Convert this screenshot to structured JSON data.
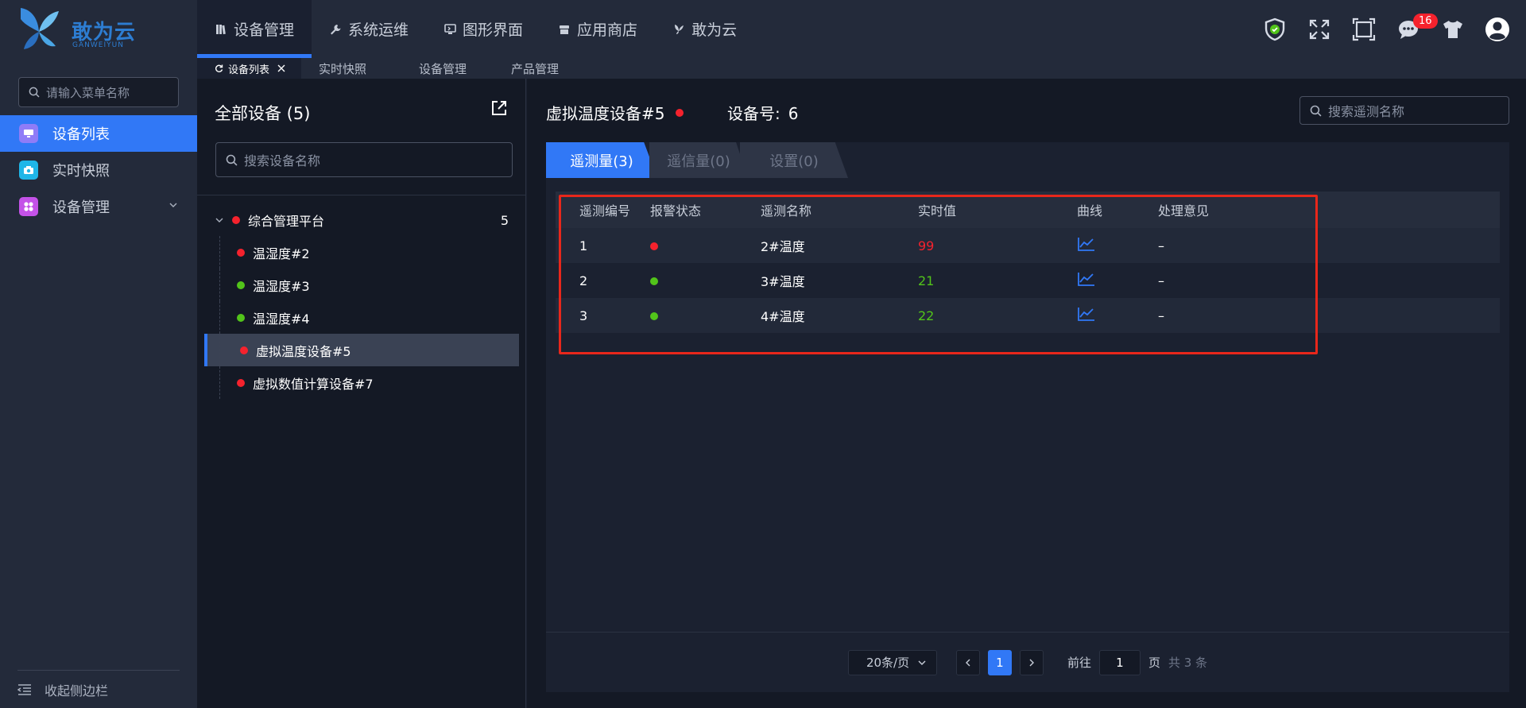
{
  "logo": {
    "text": "敢为云",
    "sub": "GANWEIYUN"
  },
  "topnav": [
    {
      "label": "设备管理",
      "icon": "book-icon",
      "active": true
    },
    {
      "label": "系统运维",
      "icon": "wrench-icon",
      "active": false
    },
    {
      "label": "图形界面",
      "icon": "monitor-icon",
      "active": false
    },
    {
      "label": "应用商店",
      "icon": "store-icon",
      "active": false
    },
    {
      "label": "敢为云",
      "icon": "butterfly-icon",
      "active": false
    }
  ],
  "topright": {
    "message_count": "16"
  },
  "sidebar": {
    "search_placeholder": "请输入菜单名称",
    "items": [
      {
        "label": "设备列表",
        "icon": "monitor-icon",
        "active": true
      },
      {
        "label": "实时快照",
        "icon": "camera-icon",
        "active": false
      },
      {
        "label": "设备管理",
        "icon": "grid-icon",
        "active": false
      }
    ],
    "collapse_label": "收起侧边栏"
  },
  "tabs": [
    {
      "label": "设备列表",
      "active": true
    },
    {
      "label": "实时快照",
      "active": false
    },
    {
      "label": "设备管理",
      "active": false
    },
    {
      "label": "产品管理",
      "active": false
    }
  ],
  "left_panel": {
    "title": "全部设备 (5)",
    "search_placeholder": "搜索设备名称",
    "tree_root": {
      "label": "综合管理平台",
      "count": "5",
      "status": "red"
    },
    "devices": [
      {
        "label": "温湿度#2",
        "status": "red",
        "selected": false
      },
      {
        "label": "温湿度#3",
        "status": "green",
        "selected": false
      },
      {
        "label": "温湿度#4",
        "status": "green",
        "selected": false
      },
      {
        "label": "虚拟温度设备#5",
        "status": "red",
        "selected": true
      },
      {
        "label": "虚拟数值计算设备#7",
        "status": "red",
        "selected": false
      }
    ]
  },
  "right_panel": {
    "device_name": "虚拟温度设备#5",
    "device_no_label": "设备号:",
    "device_no": "6",
    "search_placeholder": "搜索遥测名称",
    "subtabs": [
      {
        "label": "遥测量(3)",
        "active": true
      },
      {
        "label": "遥信量(0)",
        "active": false
      },
      {
        "label": "设置(0)",
        "active": false
      }
    ],
    "table": {
      "headers": [
        "遥测编号",
        "报警状态",
        "遥测名称",
        "实时值",
        "曲线",
        "处理意见"
      ],
      "rows": [
        {
          "no": "1",
          "alarm": "red",
          "name": "2#温度",
          "value": "99",
          "opinion": "–"
        },
        {
          "no": "2",
          "alarm": "green",
          "name": "3#温度",
          "value": "21",
          "opinion": "–"
        },
        {
          "no": "3",
          "alarm": "green",
          "name": "4#温度",
          "value": "22",
          "opinion": "–"
        }
      ]
    },
    "pager": {
      "page_size": "20条/页",
      "current_page": "1",
      "goto_label": "前往",
      "goto_value": "1",
      "page_unit": "页",
      "total": "共 3 条"
    }
  },
  "colors": {
    "accent": "#3178f6",
    "alarm_red": "#f5222d",
    "ok_green": "#52c41a",
    "highlight": "#e8271b"
  }
}
